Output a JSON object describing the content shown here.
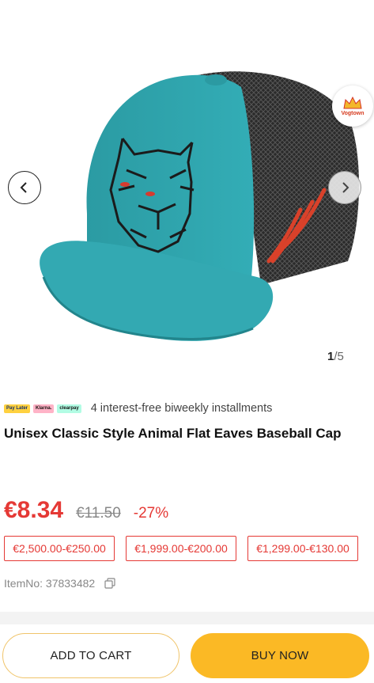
{
  "gallery": {
    "counter_current": "1",
    "counter_total": "/5",
    "badge_text": "Vogtown",
    "prev_icon": "chevron-left-icon",
    "next_icon": "chevron-right-icon"
  },
  "payment": {
    "logos": [
      "Pay Later",
      "Klarna.",
      "clearpay"
    ],
    "text": "4 interest-free biweekly installments"
  },
  "product": {
    "title": "Unisex Classic Style Animal Flat Eaves Baseball Cap",
    "price": "€8.34",
    "original_price": "€11.50",
    "discount": "-27%",
    "item_no": "ItemNo: 37833482"
  },
  "coupons": [
    "€2,500.00-€250.00",
    "€1,999.00-€200.00",
    "€1,299.00-€130.00"
  ],
  "actions": {
    "add_to_cart": "ADD TO CART",
    "buy_now": "BUY NOW"
  },
  "colors": {
    "accent_red": "#e53935",
    "buy_yellow": "#fbb925",
    "cap_teal": "#2fa3ab"
  }
}
